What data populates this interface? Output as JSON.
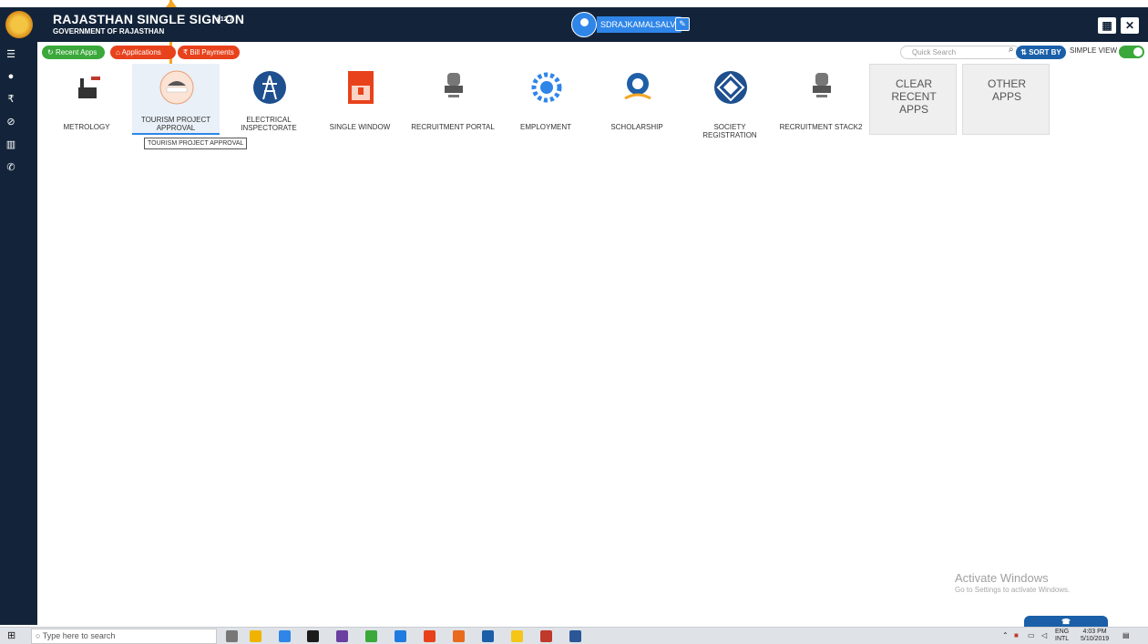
{
  "header": {
    "title": "RAJASTHAN SINGLE SIGN ON",
    "version": "v12.7",
    "subtitle": "GOVERNMENT OF RAJASTHAN",
    "user": "SDRAJKAMALSALVI"
  },
  "toolbar": {
    "recent_apps": "Recent Apps",
    "applications": "Applications",
    "bill_payments": "Bill Payments",
    "quick_search_placeholder": "Quick Search",
    "sort_by": "SORT BY",
    "simple_view": "SIMPLE VIEW",
    "simple_view_on": true
  },
  "apps": [
    {
      "label": "METROLOGY",
      "icon": "metrology-icon"
    },
    {
      "label": "TOURISM PROJECT APPROVAL",
      "icon": "rajasthan-tourism-icon",
      "active": true
    },
    {
      "label": "ELECTRICAL INSPECTORATE",
      "icon": "electric-tower-icon"
    },
    {
      "label": "SINGLE WINDOW",
      "icon": "single-window-icon"
    },
    {
      "label": "RECRUITMENT PORTAL",
      "icon": "emblem-icon"
    },
    {
      "label": "EMPLOYMENT",
      "icon": "gear-icon"
    },
    {
      "label": "SCHOLARSHIP",
      "icon": "scholarship-icon"
    },
    {
      "label": "SOCIETY REGISTRATION",
      "icon": "society-icon"
    },
    {
      "label": "RECRUITMENT STACK2",
      "icon": "emblem-icon"
    }
  ],
  "clear_recent_apps": "CLEAR RECENT APPS",
  "other_apps": "OTHER APPS",
  "tooltip": "TOURISM PROJECT APPROVAL",
  "watermark": {
    "line1": "Activate Windows",
    "line2": "Go to Settings to activate Windows."
  },
  "taskbar": {
    "search_placeholder": "Type here to search",
    "lang1": "ENG",
    "lang2": "INTL",
    "time": "4:03 PM",
    "date": "5/10/2019"
  },
  "colors": {
    "navy": "#13243a",
    "green": "#3aa83a",
    "red": "#e8421c",
    "blue": "#2f86e8"
  }
}
